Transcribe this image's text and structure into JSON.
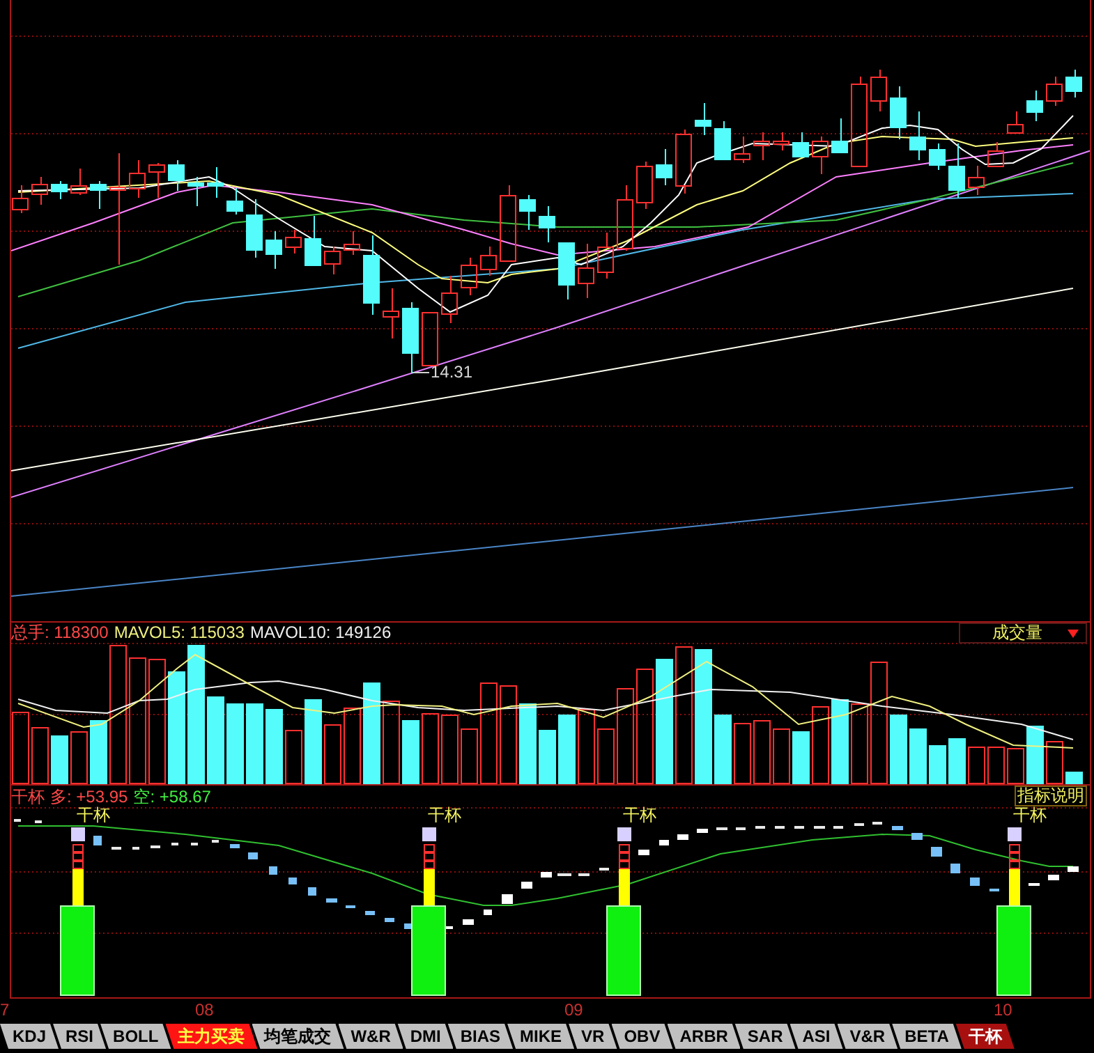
{
  "price_chart": {
    "low_price_label": "14.31"
  },
  "volume_pane": {
    "readouts": [
      {
        "text": "总手: 118300",
        "color": "#ff4848"
      },
      {
        "text": "MAVOL5: 115033",
        "color": "#f0f080"
      },
      {
        "text": "MAVOL10: 149126",
        "color": "#f0f0f0"
      }
    ],
    "indicator_select": {
      "value": "成交量"
    }
  },
  "indicator_pane": {
    "readouts": [
      {
        "text": "干杯",
        "color": "#ff4848"
      },
      {
        "text": "多: +53.95",
        "color": "#ff4848"
      },
      {
        "text": "空: +58.67",
        "color": "#40f040"
      }
    ],
    "help_button": "指标说明",
    "signals": [
      {
        "label": "干杯"
      },
      {
        "label": "干杯"
      },
      {
        "label": "干杯"
      },
      {
        "label": "干杯"
      }
    ]
  },
  "x_axis": {
    "labels": [
      "7",
      "08",
      "09",
      "10"
    ]
  },
  "tabs": [
    {
      "label": "KDJ",
      "selected": false,
      "highlighted": false
    },
    {
      "label": "RSI",
      "selected": false,
      "highlighted": false
    },
    {
      "label": "BOLL",
      "selected": false,
      "highlighted": false
    },
    {
      "label": "主力买卖",
      "selected": false,
      "highlighted": true
    },
    {
      "label": "均笔成交",
      "selected": false,
      "highlighted": false
    },
    {
      "label": "W&R",
      "selected": false,
      "highlighted": false
    },
    {
      "label": "DMI",
      "selected": false,
      "highlighted": false
    },
    {
      "label": "BIAS",
      "selected": false,
      "highlighted": false
    },
    {
      "label": "MIKE",
      "selected": false,
      "highlighted": false
    },
    {
      "label": "VR",
      "selected": false,
      "highlighted": false
    },
    {
      "label": "OBV",
      "selected": false,
      "highlighted": false
    },
    {
      "label": "ARBR",
      "selected": false,
      "highlighted": false
    },
    {
      "label": "SAR",
      "selected": false,
      "highlighted": false
    },
    {
      "label": "ASI",
      "selected": false,
      "highlighted": false
    },
    {
      "label": "V&R",
      "selected": false,
      "highlighted": false
    },
    {
      "label": "BETA",
      "selected": false,
      "highlighted": false
    },
    {
      "label": "干杯",
      "selected": true,
      "highlighted": false
    }
  ]
}
